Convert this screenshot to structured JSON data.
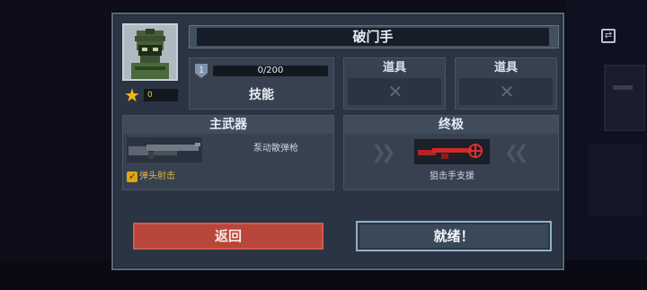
{
  "header": {
    "character_name": "破门手"
  },
  "profile": {
    "star_count": "0"
  },
  "skill": {
    "level": "1",
    "xp_text": "0/200",
    "xp_fraction": 0.0,
    "label": "技能"
  },
  "items": [
    {
      "label": "道具",
      "slot_icon": "empty-x-icon"
    },
    {
      "label": "道具",
      "slot_icon": "empty-x-icon"
    }
  ],
  "weapon": {
    "title": "主武器",
    "name": "泵动散弹枪",
    "perk": "弹头射击",
    "icon": "shotgun-icon"
  },
  "ultimate": {
    "title": "终极",
    "name": "狙击手支援",
    "icon": "sniper-rifle-icon"
  },
  "buttons": {
    "back": "返回",
    "ready": "就绪！"
  },
  "colors": {
    "panel": "#2b3443",
    "back_button": "#b8463a",
    "ready_border": "#8fb0cc",
    "star": "#f2b90f",
    "perk_text": "#e2b73a",
    "ultimate_weapon": "#d02a2a"
  }
}
